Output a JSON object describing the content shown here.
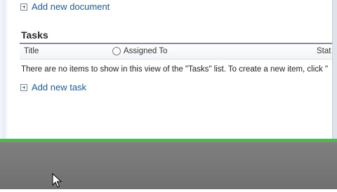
{
  "links": {
    "add_document": "Add new document",
    "add_task": "Add new task"
  },
  "tasks": {
    "title": "Tasks",
    "columns": [
      "Title",
      "Assigned To",
      "Stat"
    ],
    "empty_message": "There are no items to show in this view of the \"Tasks\" list. To create a new item, click \""
  },
  "icons": {
    "add": "add-square-icon",
    "assigned_to": "circle-icon",
    "pointer": "mouse-cursor-icon"
  },
  "colors": {
    "link": "#1b5ca8",
    "accent_line": "#39c739",
    "desktop": "#7a7a7a"
  }
}
